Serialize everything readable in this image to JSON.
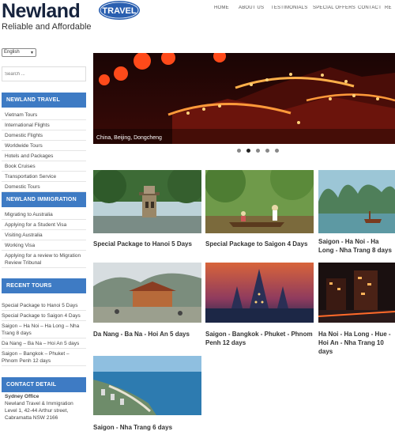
{
  "header": {
    "logo_text": "Newland",
    "badge_text": "TRAVEL",
    "tagline": "Reliable and Affordable",
    "nav": [
      "HOME",
      "ABOUT US",
      "TESTIMONIALS",
      "SPECIAL OFFERS",
      "CONTACT",
      "RE"
    ]
  },
  "sidebar": {
    "language": "English",
    "search_placeholder": "Search ...",
    "sections": {
      "travel": {
        "heading": "NEWLAND TRAVEL",
        "items": [
          "Vietnam Tours",
          "International Flights",
          "Domestic Flights",
          "Worldwide Tours",
          "Hotels and Packages",
          "Book Cruises",
          "Transportation Service",
          "Domestic Tours"
        ]
      },
      "immigration": {
        "heading": "NEWLAND IMMIGRATION",
        "items": [
          "Migrating to Australia",
          "Applying for a Student Visa",
          "Visiting Australia",
          "Working Visa",
          "Applying for a review to Migration Review Tribunal"
        ]
      },
      "recent": {
        "heading": "RECENT TOURS",
        "items": [
          "Special Package to Hanoi 5 Days",
          "Special Package to Saigon 4 Days",
          "Saigon – Ha Noi – Ha Long – Nha Trang 8 days",
          "Da Nang – Ba Na – Hoi An 5 days",
          "Saigon – Bangkok – Phuket – Phnom Penh 12 days"
        ]
      },
      "contact": {
        "heading": "CONTACT DETAIL",
        "office": "Sydney Office",
        "company": "Newland Travel & Immigration",
        "address1": "Level 1, 42-44 Arthur street,",
        "address2": "Cabramatta NSW 2166"
      }
    }
  },
  "hero": {
    "caption": "China, Beijing, Dongcheng",
    "slide_count": 5,
    "active_slide": 2
  },
  "tours": [
    {
      "title": "Special Package to Hanoi 5 Days"
    },
    {
      "title": "Special Package to Saigon 4 Days"
    },
    {
      "title": "Saigon - Ha Noi - Ha Long - Nha Trang 8 days"
    },
    {
      "title": "Da Nang - Ba Na - Hoi An 5 days"
    },
    {
      "title": "Saigon - Bangkok - Phuket - Phnom Penh 12 days"
    },
    {
      "title": "Ha Noi - Ha Long - Hue - Hoi An - Nha Trang 10 days"
    },
    {
      "title": "Saigon - Nha Trang 6 days"
    }
  ],
  "colors": {
    "accent": "#3e7bc4",
    "logo": "#16233d"
  }
}
